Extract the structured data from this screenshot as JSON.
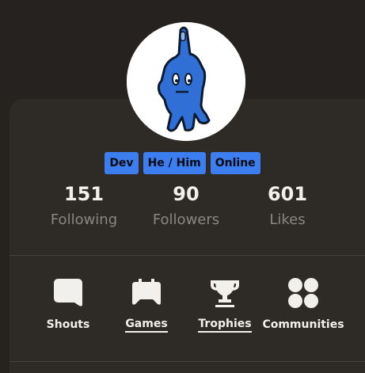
{
  "profile": {
    "badges": [
      "Dev",
      "He / Him",
      "Online"
    ],
    "badge_color": "#3c7df0"
  },
  "stats": [
    {
      "value": "151",
      "label": "Following"
    },
    {
      "value": "90",
      "label": "Followers"
    },
    {
      "value": "601",
      "label": "Likes"
    }
  ],
  "nav": [
    {
      "label": "Shouts",
      "icon": "speech-bubble-icon"
    },
    {
      "label": "Games",
      "icon": "gamepad-icon"
    },
    {
      "label": "Trophies",
      "icon": "trophy-icon"
    },
    {
      "label": "Communities",
      "icon": "four-circles-icon"
    }
  ],
  "colors": {
    "background": "#252220",
    "card": "#2e2b27",
    "text": "#f2f0ed",
    "muted": "#8a8682"
  }
}
